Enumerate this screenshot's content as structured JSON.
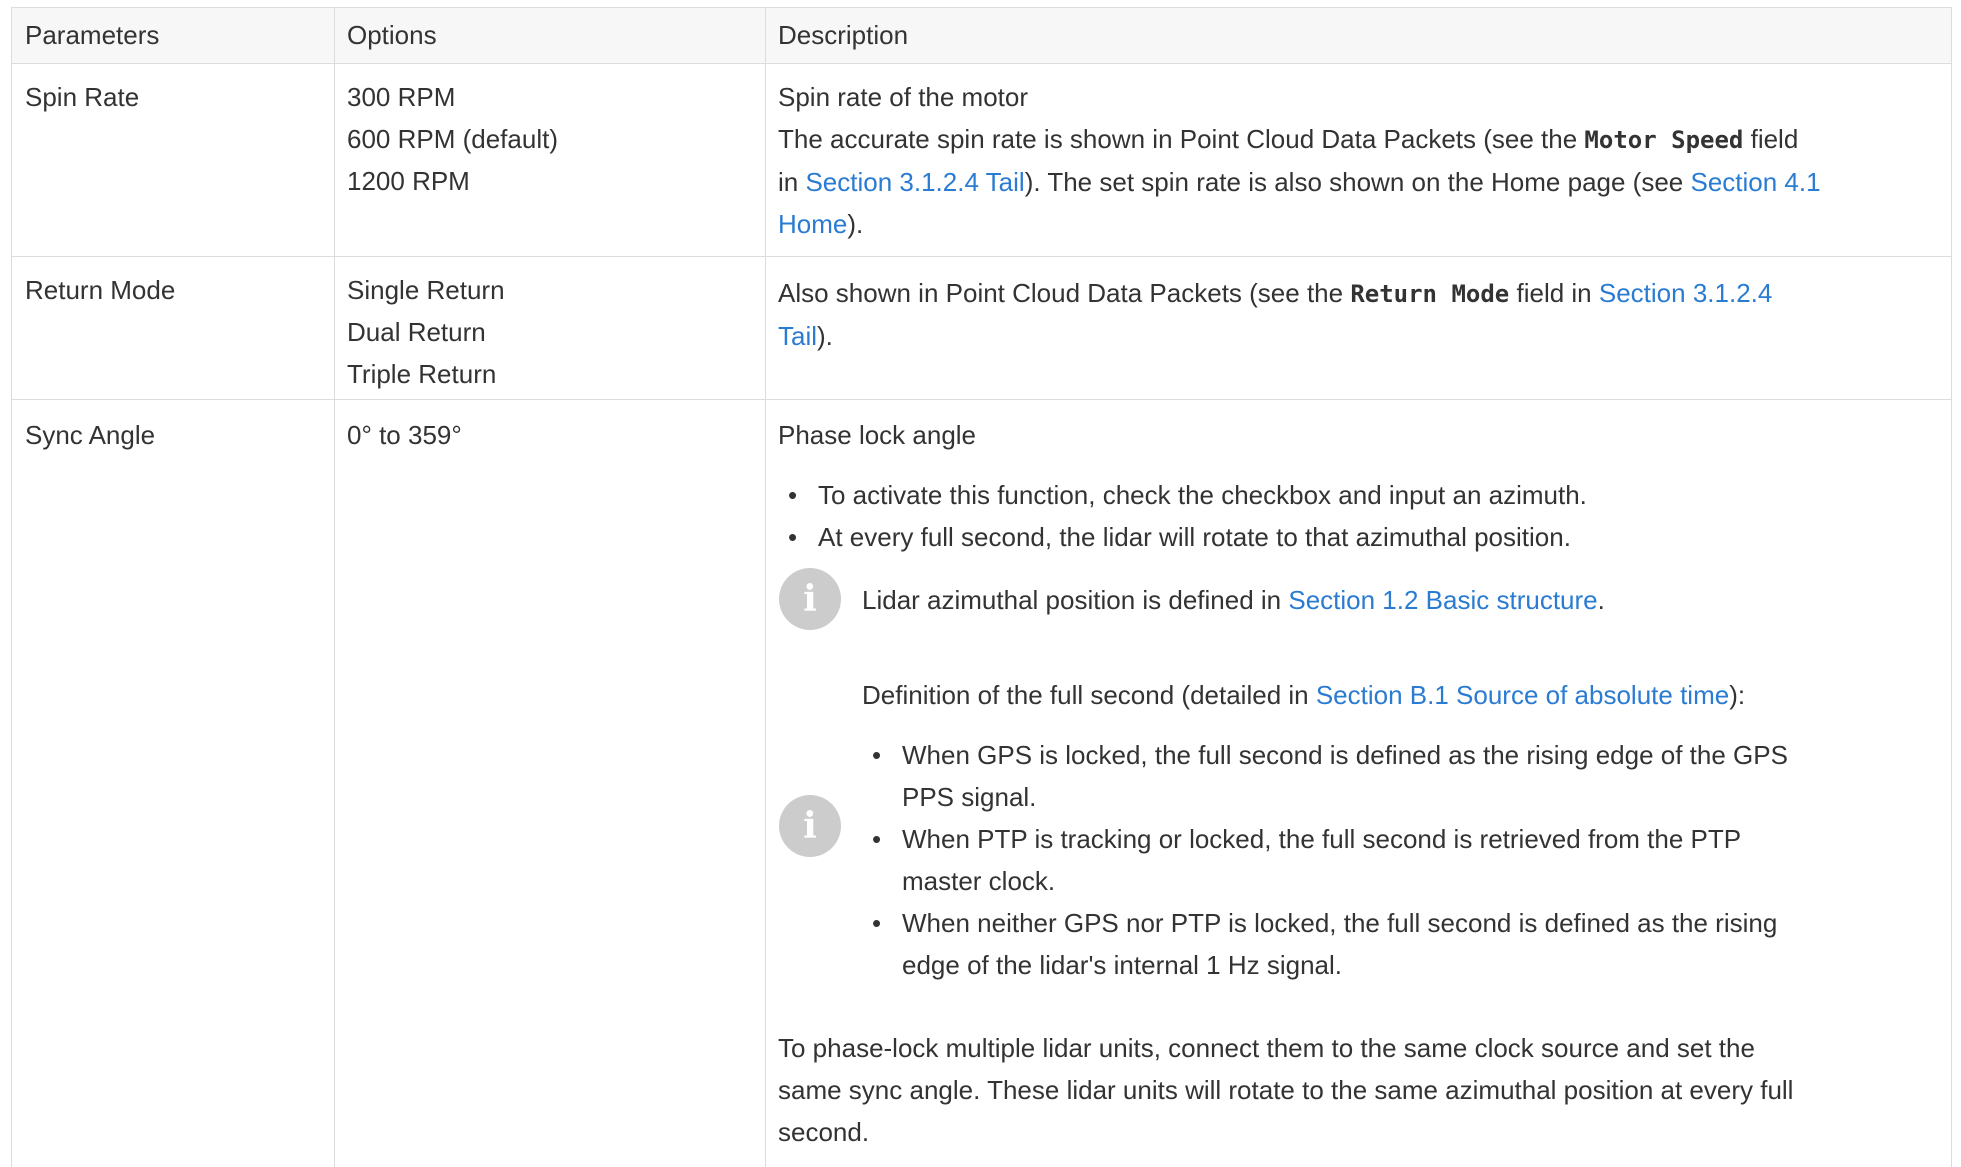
{
  "header": {
    "parameters": "Parameters",
    "options": "Options",
    "description": "Description"
  },
  "rows": {
    "spin_rate": {
      "parameter": "Spin Rate",
      "options": [
        "300 RPM",
        "600 RPM (default)",
        "1200 RPM"
      ],
      "desc_title": "Spin rate of the motor",
      "desc_l1_pre": "The accurate spin rate is shown in Point Cloud Data Packets (see the ",
      "desc_l1_code": "Motor Speed",
      "desc_l1_post": " field",
      "desc_l2_pre": "in ",
      "desc_l2_link": "Section 3.1.2.4 Tail",
      "desc_l2_mid": "). The set spin rate is also shown on the Home page (see ",
      "desc_l2_link2": "Section 4.1",
      "desc_l3_link": "Home",
      "desc_l3_post": ")."
    },
    "return_mode": {
      "parameter": "Return Mode",
      "options": [
        "Single Return",
        "Dual Return",
        "Triple Return"
      ],
      "desc_l1_pre": "Also shown in Point Cloud Data Packets (see the ",
      "desc_l1_code": "Return Mode",
      "desc_l1_post": " field in ",
      "desc_l1_link": "Section 3.1.2.4",
      "desc_l2_link": "Tail",
      "desc_l2_post": ")."
    },
    "sync_angle": {
      "parameter": "Sync Angle",
      "options": [
        "0° to 359°"
      ],
      "desc_title": "Phase lock angle",
      "bullets": [
        "To activate this function, check the checkbox and input an azimuth.",
        "At every full second, the lidar will rotate to that azimuthal position."
      ],
      "note1_pre": "Lidar azimuthal position is defined in ",
      "note1_link": "Section 1.2 Basic structure",
      "note1_post": ".",
      "note2_pre": "Definition of the full second (detailed in ",
      "note2_link": "Section B.1 Source of absolute time",
      "note2_post": "):",
      "note2_bullets": [
        [
          "When GPS is locked, the full second is defined as the rising edge of the GPS",
          "PPS signal."
        ],
        [
          "When PTP is tracking or locked, the full second is retrieved from the PTP",
          "master clock."
        ],
        [
          "When neither GPS nor PTP is locked, the full second is defined as the rising",
          "edge of the lidar's internal 1 Hz signal."
        ]
      ],
      "footer": [
        "To phase-lock multiple lidar units, connect them to the same clock source and set the",
        "same sync angle. These lidar units will rotate to the same azimuthal position at every full",
        "second."
      ]
    }
  },
  "icons": {
    "note": "info-icon"
  },
  "colors": {
    "link": "#2a7bd2",
    "header_bg": "#f7f7f7",
    "border": "#dcdcdc",
    "icon": "#cccccc"
  }
}
